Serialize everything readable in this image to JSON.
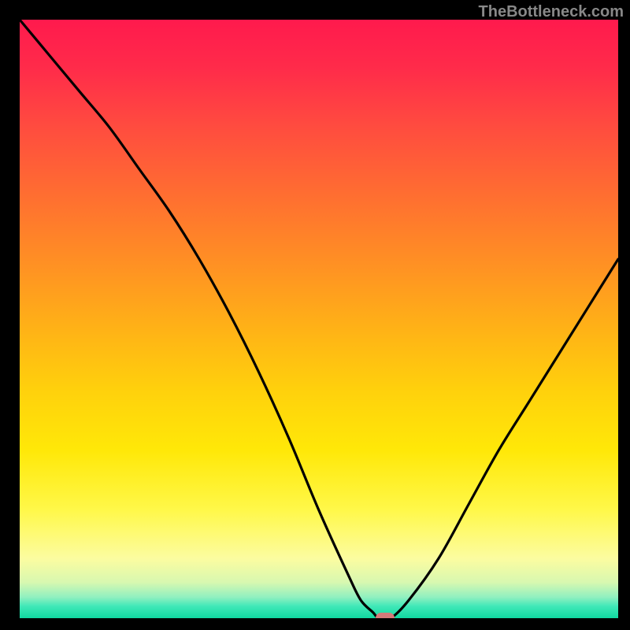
{
  "watermark": "TheBottleneck.com",
  "chart_data": {
    "type": "line",
    "title": "",
    "xlabel": "",
    "ylabel": "",
    "xlim": [
      0,
      100
    ],
    "ylim": [
      0,
      100
    ],
    "series": [
      {
        "name": "bottleneck-curve",
        "x": [
          0,
          5,
          10,
          15,
          20,
          25,
          30,
          35,
          40,
          45,
          50,
          55,
          57,
          59,
          60,
          62,
          65,
          70,
          75,
          80,
          85,
          90,
          95,
          100
        ],
        "y": [
          100,
          94,
          88,
          82,
          75,
          68,
          60,
          51,
          41,
          30,
          18,
          7,
          3,
          1,
          0,
          0,
          3,
          10,
          19,
          28,
          36,
          44,
          52,
          60
        ]
      }
    ],
    "marker": {
      "x": 61,
      "y": 0,
      "name": "optimal-point"
    },
    "background_gradient": {
      "top": "#ff1a4d",
      "mid": "#ffd10c",
      "bottom": "#10d8a0"
    }
  }
}
